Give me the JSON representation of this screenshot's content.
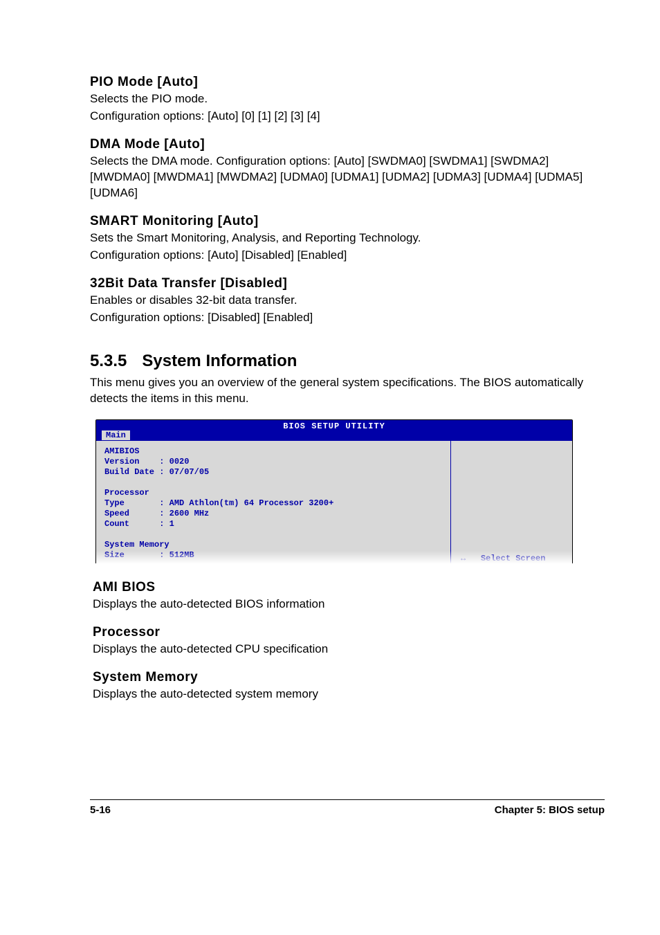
{
  "settings": {
    "pio": {
      "heading": "PIO Mode [Auto]",
      "line1": "Selects the PIO mode.",
      "line2": "Configuration options: [Auto] [0] [1] [2] [3] [4]"
    },
    "dma": {
      "heading": "DMA Mode [Auto]",
      "desc": "Selects the DMA mode. Configuration options: [Auto] [SWDMA0] [SWDMA1] [SWDMA2] [MWDMA0] [MWDMA1] [MWDMA2] [UDMA0] [UDMA1] [UDMA2] [UDMA3] [UDMA4] [UDMA5] [UDMA6]"
    },
    "smart": {
      "heading": "SMART Monitoring [Auto]",
      "line1": "Sets the Smart Monitoring, Analysis, and Reporting Technology.",
      "line2": "Configuration options: [Auto] [Disabled] [Enabled]"
    },
    "transfer": {
      "heading": "32Bit Data Transfer [Disabled]",
      "line1": "Enables or disables 32-bit data transfer.",
      "line2": "Configuration options: [Disabled] [Enabled]"
    }
  },
  "section": {
    "num": "5.3.5",
    "title": "System Information",
    "intro": "This menu gives you an overview of the general system specifications. The BIOS automatically detects the items in this menu."
  },
  "bios": {
    "title": "BIOS SETUP UTILITY",
    "tab": "Main",
    "amibios_label": "AMIBIOS",
    "version_label": "Version",
    "version_value": "0020",
    "build_label": "Build Date",
    "build_value": "07/07/05",
    "processor_label": "Processor",
    "type_label": "Type",
    "type_value": "AMD Athlon(tm) 64 Processor 3200+",
    "speed_label": "Speed",
    "speed_value": "2600 MHz",
    "count_label": "Count",
    "count_value": "1",
    "memory_label": "System Memory",
    "size_label": "Size",
    "size_value": "512MB",
    "legend_arrow": "↔",
    "legend_text": "Select Screen"
  },
  "subs": {
    "ami": {
      "heading": "AMI BIOS",
      "desc": "Displays the auto-detected BIOS information"
    },
    "proc": {
      "heading": "Processor",
      "desc": "Displays the auto-detected CPU specification"
    },
    "mem": {
      "heading": "System Memory",
      "desc": "Displays the auto-detected system memory"
    }
  },
  "footer": {
    "left": "5-16",
    "right": "Chapter 5: BIOS setup"
  }
}
